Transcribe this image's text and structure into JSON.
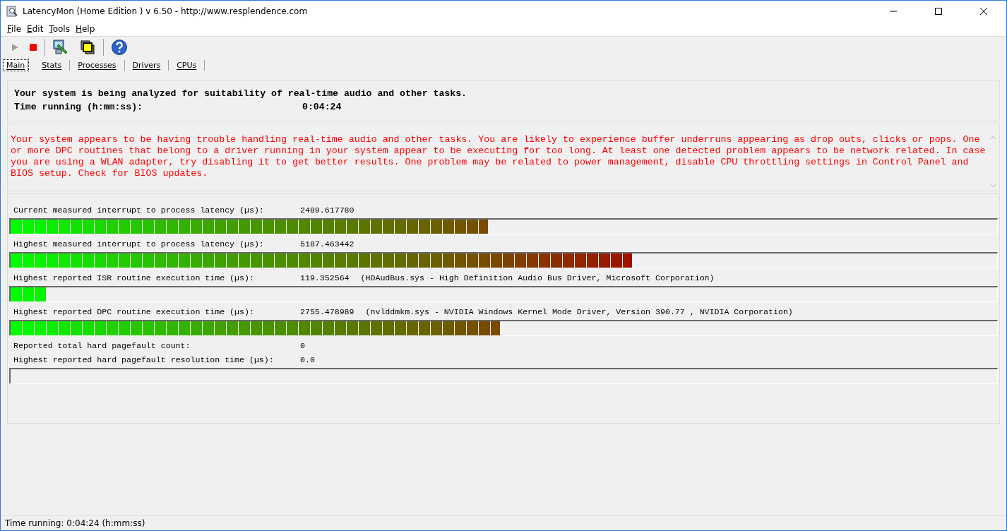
{
  "window": {
    "title": "LatencyMon  (Home Edition )  v 6.50 - http://www.resplendence.com"
  },
  "menu": [
    {
      "label": "File"
    },
    {
      "label": "Edit"
    },
    {
      "label": "Tools"
    },
    {
      "label": "Help"
    }
  ],
  "toolbar": [
    {
      "kind": "play",
      "disabled": true
    },
    {
      "kind": "stop",
      "disabled": false
    },
    {
      "kind": "separator"
    },
    {
      "kind": "monitor",
      "disabled": false
    },
    {
      "kind": "windows",
      "disabled": false
    },
    {
      "kind": "separator"
    },
    {
      "kind": "help",
      "disabled": false
    }
  ],
  "tabs": [
    {
      "label": "Main",
      "selected": true
    },
    {
      "label": "Stats",
      "selected": false
    },
    {
      "label": "Processes",
      "selected": false
    },
    {
      "label": "Drivers",
      "selected": false
    },
    {
      "label": "CPUs",
      "selected": false
    }
  ],
  "status": {
    "message": "Your system is being analyzed for suitability of real-time audio and other tasks.",
    "time_label": "Time running (h:mm:ss):",
    "time_value": "0:04:24"
  },
  "conclusion": "Your system appears to be having trouble handling real-time audio and other tasks. You are likely to experience buffer underruns appearing as drop outs, clicks or pops. One or more DPC routines that belong to a driver running in your system appear to be executing for too long. At least one detected problem appears to be network related. In case you are using a WLAN adapter, try disabling it to get better results. One problem may be related to power management, disable CPU throttling settings in Control Panel and BIOS setup. Check for BIOS updates.",
  "measurements": [
    {
      "kind": "bar",
      "label": "Current measured interrupt to process latency (µs):",
      "value": "2489.617780",
      "level": 0.484
    },
    {
      "kind": "bar",
      "label": "Highest measured interrupt to process latency (µs):",
      "value": "5187.463442",
      "level": 0.63
    },
    {
      "kind": "bar",
      "label": "Highest reported ISR routine execution time (µs):",
      "value": "119.352564",
      "detail": "(HDAudBus.sys - High Definition Audio Bus Driver, Microsoft Corporation)",
      "level": 0.036
    },
    {
      "kind": "bar",
      "label": "Highest reported DPC routine execution time (µs):",
      "value": "2755.478989",
      "detail": "(nvlddmkm.sys - NVIDIA Windows Kernel Mode Driver, Version 390.77 , NVIDIA Corporation)",
      "level": 0.496
    },
    {
      "kind": "text",
      "label": "Reported total hard pagefault count:",
      "value": "0"
    },
    {
      "kind": "bar",
      "label": "Highest reported hard pagefault resolution time (µs):",
      "value": "0.0",
      "level": 0
    }
  ],
  "status_bar": "Time running: 0:04:24  (h:mm:ss)"
}
